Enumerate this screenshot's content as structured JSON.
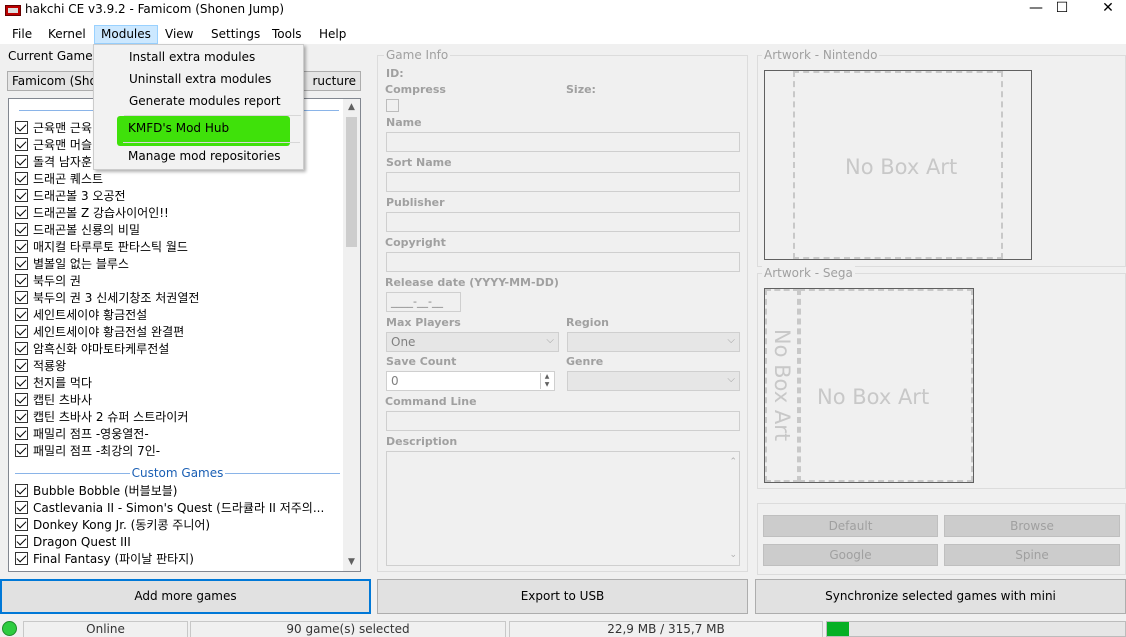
{
  "window": {
    "title": "hakchi CE v3.9.2 - Famicom (Shonen Jump)",
    "minimize": "—",
    "maximize": "☐",
    "close": "✕"
  },
  "menubar": {
    "items": [
      {
        "label": "File"
      },
      {
        "label": "Kernel"
      },
      {
        "label": "Modules"
      },
      {
        "label": "View"
      },
      {
        "label": "Settings"
      },
      {
        "label": "Tools"
      },
      {
        "label": "Help"
      }
    ]
  },
  "modules_menu": {
    "items": [
      {
        "label": "Install extra modules"
      },
      {
        "label": "Uninstall extra modules"
      },
      {
        "label": "Generate modules report"
      },
      {
        "label": "KMFD's Mod Hub"
      },
      {
        "label": "Manage mod repositories"
      }
    ],
    "highlight_color": "#3fe10a"
  },
  "left": {
    "current_games_label": "Current Games",
    "console_combo": "Famicom (Shonen Jump)",
    "structure_combo": "ructure",
    "games": [
      {
        "name": "근육맨 근육",
        "checked": true
      },
      {
        "name": "근육맨 머슬",
        "checked": true
      },
      {
        "name": "돌격 남자훈",
        "checked": true
      },
      {
        "name": "드래곤 퀘스트",
        "checked": true
      },
      {
        "name": "드래곤볼 3 오공전",
        "checked": true
      },
      {
        "name": "드래곤볼 Z 강습사이어인!!",
        "checked": true
      },
      {
        "name": "드래곤볼 신룡의 비밀",
        "checked": true
      },
      {
        "name": "매지컬 타루루토 판타스틱 월드",
        "checked": true
      },
      {
        "name": "별볼일 없는 블루스",
        "checked": true
      },
      {
        "name": "북두의 권",
        "checked": true
      },
      {
        "name": "북두의 권 3 신세기창조 처권열전",
        "checked": true
      },
      {
        "name": "세인트세이야 황금전설",
        "checked": true
      },
      {
        "name": "세인트세이야 황금전설 완결편",
        "checked": true
      },
      {
        "name": "암흑신화 야마토타케루전설",
        "checked": true
      },
      {
        "name": "적룡왕",
        "checked": true
      },
      {
        "name": "천지를 먹다",
        "checked": true
      },
      {
        "name": "캡틴 츠바사",
        "checked": true
      },
      {
        "name": "캡틴 츠바사 2 슈퍼 스트라이커",
        "checked": true
      },
      {
        "name": "패밀리 점프 -영웅열전-",
        "checked": true
      },
      {
        "name": "패밀리 점프 -최강의 7인-",
        "checked": true
      }
    ],
    "custom_group_label": "Custom Games",
    "custom_games": [
      {
        "name": "Bubble Bobble (버블보블)",
        "checked": true
      },
      {
        "name": "Castlevania II - Simon's Quest (드라큘라 II 저주의...",
        "checked": true
      },
      {
        "name": "Donkey Kong Jr. (동키콩 주니어)",
        "checked": true
      },
      {
        "name": "Dragon Quest III",
        "checked": true
      },
      {
        "name": "Final Fantasy (파이날 판타지)",
        "checked": true
      }
    ]
  },
  "game_info": {
    "title": "Game Info",
    "id_label": "ID:",
    "compress_label": "Compress",
    "size_label": "Size:",
    "name_label": "Name",
    "sort_name_label": "Sort Name",
    "publisher_label": "Publisher",
    "copyright_label": "Copyright",
    "release_label": "Release date (YYYY-MM-DD)",
    "release_value": "____-__-__",
    "max_players_label": "Max Players",
    "max_players_value": "One",
    "region_label": "Region",
    "save_count_label": "Save Count",
    "save_count_value": "0",
    "genre_label": "Genre",
    "command_line_label": "Command Line",
    "description_label": "Description"
  },
  "artwork": {
    "nintendo_title": "Artwork - Nintendo",
    "sega_title": "Artwork - Sega",
    "no_box_art": "No Box Art",
    "buttons": {
      "default": "Default",
      "browse": "Browse",
      "google": "Google",
      "spine": "Spine"
    }
  },
  "bottom": {
    "add_more_games": "Add more games",
    "export_usb": "Export to USB",
    "synchronize": "Synchronize selected games with mini"
  },
  "status": {
    "online": "Online",
    "selected": "90 game(s) selected",
    "storage": "22,9 MB / 315,7 MB",
    "storage_fraction": 0.073,
    "indicator_color": "#2ecc40"
  }
}
